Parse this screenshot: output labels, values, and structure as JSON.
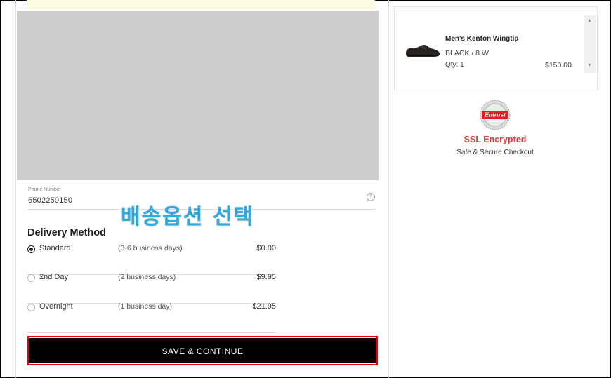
{
  "contact": {
    "phone_label": "Phone Number",
    "phone_value": "6502250150"
  },
  "annotation": {
    "text": "배송옵션 선택"
  },
  "delivery": {
    "title": "Delivery Method",
    "options": [
      {
        "name": "Standard",
        "days": "(3-6 business days)",
        "price": "$0.00",
        "selected": true
      },
      {
        "name": "2nd Day",
        "days": "(2 business days)",
        "price": "$9.95",
        "selected": false
      },
      {
        "name": "Overnight",
        "days": "(1 business day)",
        "price": "$21.95",
        "selected": false
      }
    ]
  },
  "actions": {
    "save_label": "SAVE & CONTINUE"
  },
  "cart": {
    "item": {
      "name": "Men's Kenton Wingtip",
      "variant": "BLACK / 8 W",
      "qty": "Qty: 1",
      "price": "$150.00"
    }
  },
  "security": {
    "seal_text": "Entrust",
    "title": "SSL Encrypted",
    "subtitle": "Safe & Secure Checkout"
  },
  "colors": {
    "accent_red": "#e23b3b",
    "annotation_blue": "#35a9d9",
    "button_bg": "#000000"
  }
}
